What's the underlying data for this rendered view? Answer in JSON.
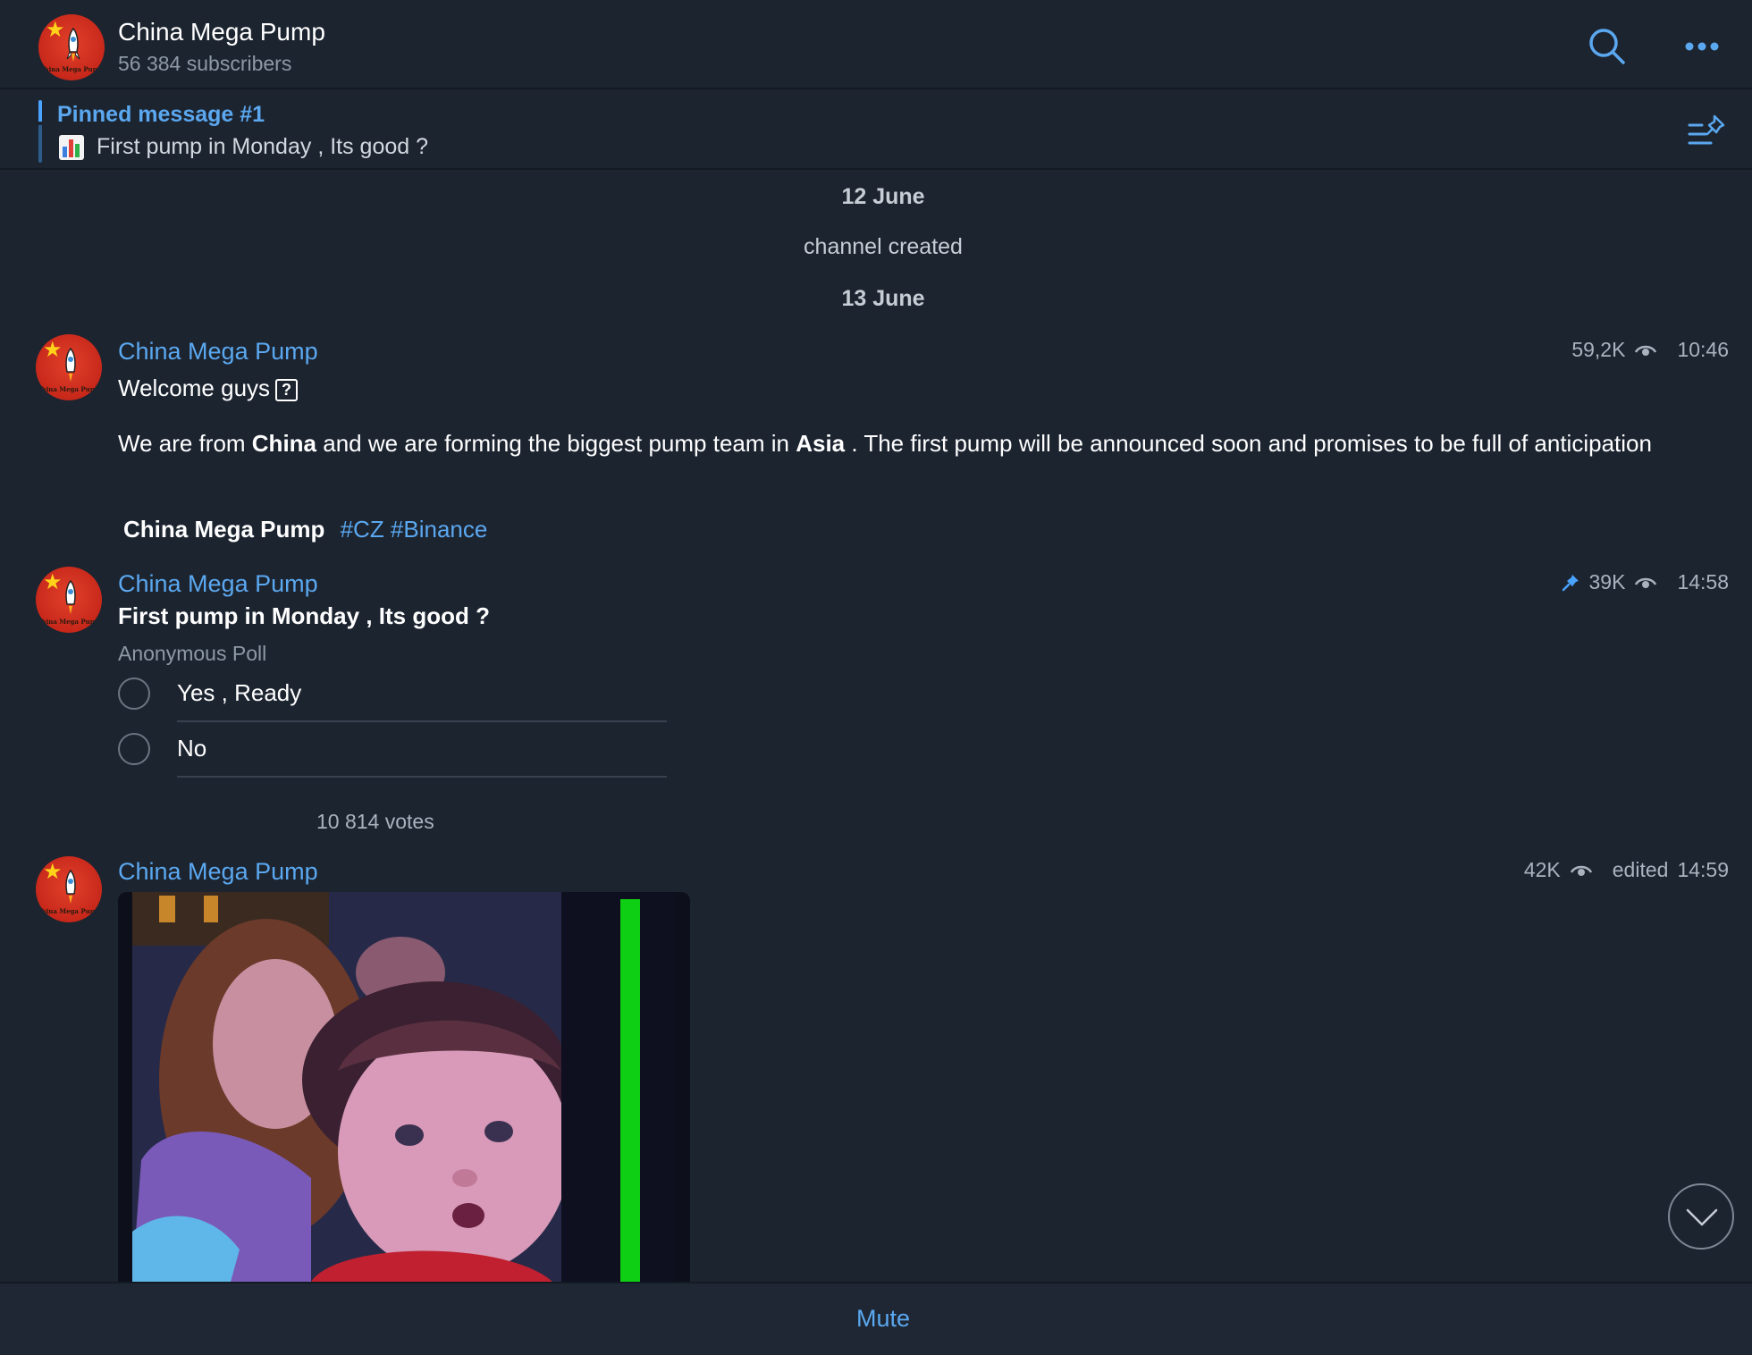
{
  "header": {
    "title": "China Mega Pump",
    "subtitle": "56 384 subscribers",
    "avatar_text": "China Mega Pump",
    "icons": [
      "search-icon",
      "more-icon"
    ]
  },
  "pinned": {
    "title": "Pinned message #1",
    "text": "First pump in Monday , Its good ?",
    "icon": "pinned-list-icon"
  },
  "dates": {
    "first": "12 June",
    "second": "13 June"
  },
  "service": {
    "created": "channel created"
  },
  "messages": [
    {
      "author": "China Mega Pump",
      "views": "59,2K",
      "time": "10:46",
      "line1": "Welcome guys",
      "para_1": "We are from ",
      "bold_1": "China",
      "para_2": " and we are forming the biggest pump team in ",
      "bold_2": "Asia",
      "para_3": " . The first pump will be announced soon and promises to be full of anticipation",
      "signature": "China Mega Pump",
      "hashtags": "#CZ #Binance"
    },
    {
      "author": "China Mega Pump",
      "views": "39K",
      "time": "14:58",
      "poll": {
        "question": "First pump in Monday , Its good ?",
        "type": "Anonymous Poll",
        "options": [
          "Yes , Ready",
          "No"
        ],
        "votes": "10 814 votes"
      }
    },
    {
      "author": "China Mega Pump",
      "views": "42K",
      "edited": "edited",
      "time": "14:59"
    }
  ],
  "bottom": {
    "mute_label": "Mute"
  },
  "colors": {
    "background": "#1c2430",
    "accent": "#5ba8f0",
    "secondary_text": "#8e99a6"
  }
}
